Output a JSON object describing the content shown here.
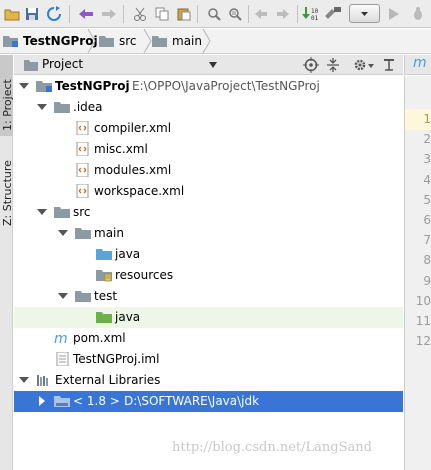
{
  "breadcrumb": {
    "items": [
      "TestNGProj",
      "src",
      "main"
    ]
  },
  "left_strip": {
    "tabs": [
      {
        "label": "1: Project",
        "active": true
      },
      {
        "label": "Z: Structure",
        "active": false
      }
    ]
  },
  "project_panel": {
    "title": "Project",
    "selector": "Project"
  },
  "tree": [
    {
      "label": "TestNGProj",
      "extra": "E:\\OPPO\\JavaProject\\TestNGProj",
      "icon": "project-folder-icon",
      "arrow": "down"
    },
    {
      "label": ".idea",
      "icon": "folder-icon",
      "arrow": "down"
    },
    {
      "label": "compiler.xml",
      "icon": "xml-file-icon"
    },
    {
      "label": "misc.xml",
      "icon": "xml-file-icon"
    },
    {
      "label": "modules.xml",
      "icon": "xml-file-icon"
    },
    {
      "label": "workspace.xml",
      "icon": "xml-file-icon"
    },
    {
      "label": "src",
      "icon": "folder-icon",
      "arrow": "down"
    },
    {
      "label": "main",
      "icon": "folder-icon",
      "arrow": "down"
    },
    {
      "label": "java",
      "icon": "source-folder-icon"
    },
    {
      "label": "resources",
      "icon": "resources-folder-icon"
    },
    {
      "label": "test",
      "icon": "folder-icon",
      "arrow": "down"
    },
    {
      "label": "java",
      "icon": "test-folder-icon"
    },
    {
      "label": "pom.xml",
      "icon": "maven-icon"
    },
    {
      "label": "TestNGProj.iml",
      "icon": "iml-file-icon"
    },
    {
      "label": "External Libraries",
      "icon": "libraries-icon",
      "arrow": "down"
    },
    {
      "label": "< 1.8 >",
      "extra": "D:\\SOFTWARE\\Java\\jdk",
      "icon": "jdk-icon",
      "arrow": "right"
    }
  ],
  "editor": {
    "tab_glyph": "m",
    "line_numbers": [
      "1",
      "2",
      "3",
      "4",
      "5",
      "6",
      "7",
      "8",
      "9",
      "10",
      "11",
      "12"
    ]
  },
  "watermark": "http://blog.csdn.net/LangSand",
  "colors": {
    "selection": "#3875d7",
    "folder": "#8c9aa3",
    "source_folder": "#59a5d9",
    "test_folder": "#6bb14a",
    "maven": "#4aa0d4"
  }
}
